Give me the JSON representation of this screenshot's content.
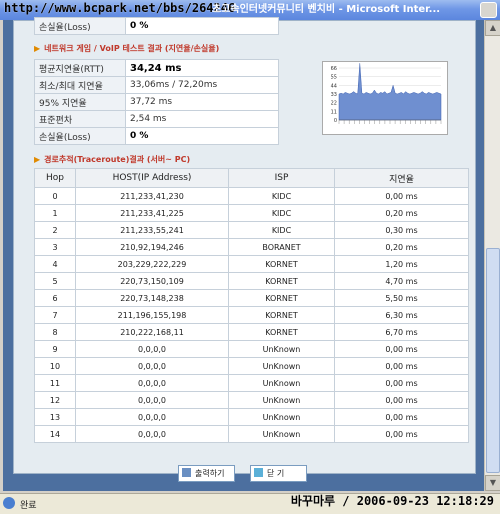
{
  "window": {
    "url_overlay": "http://www.bcpark.net/bbs/264246",
    "title": "초고속인터넷커뮤니티 벤치비 - Microsoft Inter..."
  },
  "summary_top": {
    "rows": [
      {
        "label": "손실율(Loss)",
        "value": "0 %"
      }
    ]
  },
  "network_section": {
    "heading": "네트워크 게임 / VoIP 테스트 결과 (지연율/손실율)",
    "rows": [
      {
        "label": "평균지연율(RTT)",
        "value": "34,24 ms",
        "bold": true
      },
      {
        "label": "최소/최대 지연율",
        "value": "33,06ms / 72,20ms"
      },
      {
        "label": "95% 지연율",
        "value": "37,72 ms"
      },
      {
        "label": "표준편차",
        "value": "2,54 ms"
      },
      {
        "label": "손실율(Loss)",
        "value": "0 %",
        "bold": true
      }
    ]
  },
  "chart_data": {
    "type": "area",
    "y_ticks": [
      "66",
      "55",
      "44",
      "33",
      "22",
      "11",
      "0"
    ],
    "values": [
      33,
      34,
      33,
      35,
      34,
      33,
      34,
      36,
      34,
      33,
      72,
      34,
      33,
      35,
      34,
      33,
      34,
      38,
      34,
      33,
      35,
      34,
      36,
      33,
      34,
      35,
      44,
      34,
      33,
      34,
      35,
      33,
      36,
      34,
      33,
      34,
      35,
      34,
      33,
      34,
      36,
      34,
      33,
      35,
      34,
      33,
      34,
      35,
      34,
      33
    ]
  },
  "trace_section": {
    "heading": "경로추적(Traceroute)결과 (서버~ PC)",
    "columns": [
      "Hop",
      "HOST(IP Address)",
      "ISP",
      "지연율"
    ],
    "rows": [
      [
        "0",
        "211,233,41,230",
        "KIDC",
        "0,00 ms"
      ],
      [
        "1",
        "211,233,41,225",
        "KIDC",
        "0,20 ms"
      ],
      [
        "2",
        "211,233,55,241",
        "KIDC",
        "0,30 ms"
      ],
      [
        "3",
        "210,92,194,246",
        "BORANET",
        "0,20 ms"
      ],
      [
        "4",
        "203,229,222,229",
        "KORNET",
        "1,20 ms"
      ],
      [
        "5",
        "220,73,150,109",
        "KORNET",
        "4,70 ms"
      ],
      [
        "6",
        "220,73,148,238",
        "KORNET",
        "5,50 ms"
      ],
      [
        "7",
        "211,196,155,198",
        "KORNET",
        "6,30 ms"
      ],
      [
        "8",
        "210,222,168,11",
        "KORNET",
        "6,70 ms"
      ],
      [
        "9",
        "0,0,0,0",
        "UnKnown",
        "0,00 ms"
      ],
      [
        "10",
        "0,0,0,0",
        "UnKnown",
        "0,00 ms"
      ],
      [
        "11",
        "0,0,0,0",
        "UnKnown",
        "0,00 ms"
      ],
      [
        "12",
        "0,0,0,0",
        "UnKnown",
        "0,00 ms"
      ],
      [
        "13",
        "0,0,0,0",
        "UnKnown",
        "0,00 ms"
      ],
      [
        "14",
        "0,0,0,0",
        "UnKnown",
        "0,00 ms"
      ]
    ]
  },
  "buttons": {
    "print": "출력하기",
    "close": "닫 기"
  },
  "statusbar": {
    "text": "완료",
    "stamp": "바꾸마루 / 2006-09-23 12:18:29"
  }
}
